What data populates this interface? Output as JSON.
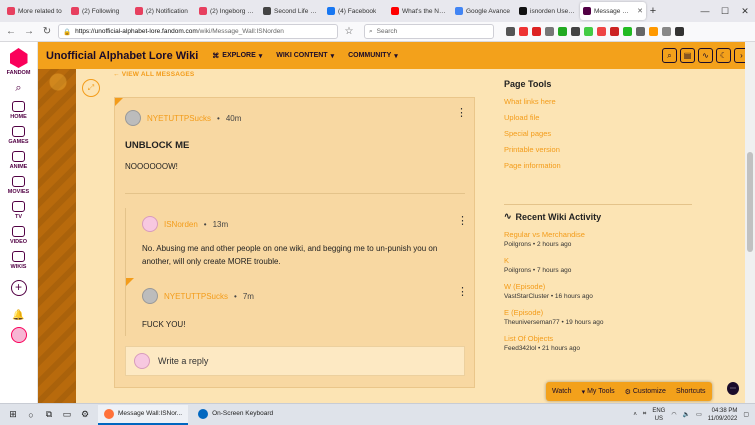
{
  "browser": {
    "tabs": [
      {
        "label": "More related to",
        "color": "#e7405f"
      },
      {
        "label": "(2) Following",
        "color": "#e7405f"
      },
      {
        "label": "(2) Notification",
        "color": "#e7405f"
      },
      {
        "label": "(2) Ingeborg Ne",
        "color": "#e7405f"
      },
      {
        "label": "Second Life Ma",
        "color": "#444444"
      },
      {
        "label": "(4) Facebook",
        "color": "#1877f2"
      },
      {
        "label": "What's the New",
        "color": "#ff0000"
      },
      {
        "label": "Google Avance",
        "color": "#4285f4"
      },
      {
        "label": "isnorden User P",
        "color": "#111111"
      },
      {
        "label": "Message Wall",
        "color": "#520044"
      }
    ],
    "url_host": "https://unofficial-alphabet-lore.fandom.com",
    "url_path": "/wiki/Message_Wall:ISNorden",
    "search_placeholder": "Search"
  },
  "rail": {
    "brand": "FANDOM",
    "items": [
      "HOME",
      "GAMES",
      "ANIME",
      "MOVIES",
      "TV",
      "VIDEO",
      "WIKIS"
    ]
  },
  "wiki": {
    "title": "Unofficial Alphabet Lore Wiki",
    "nav": [
      "EXPLORE",
      "WIKI CONTENT",
      "COMMUNITY"
    ],
    "accent": "#f39c1a"
  },
  "thread": {
    "view_all": "VIEW ALL MESSAGES",
    "post": {
      "author": "NYETUTTPSucks",
      "time": "40m",
      "title": "UNBLOCK ME",
      "body": "NOOOOOOW!"
    },
    "replies": [
      {
        "author": "ISNorden",
        "time": "13m",
        "text": "No.  Abusing me and other people on one wiki, and begging me to un-punish you on another, will only create MORE trouble."
      },
      {
        "author": "NYETUTTPSucks",
        "time": "7m",
        "text": "FUCK YOU!"
      }
    ],
    "reply_placeholder": "Write a reply"
  },
  "sidebar": {
    "page_tools_title": "Page Tools",
    "page_tools": [
      "What links here",
      "Upload file",
      "Special pages",
      "Printable version",
      "Page information"
    ],
    "activity_title": "Recent Wiki Activity",
    "activity": [
      {
        "title": "Regular vs Merchandise",
        "meta": "Poilgrons • 2 hours ago"
      },
      {
        "title": "K",
        "meta": "Poilgrons • 7 hours ago"
      },
      {
        "title": "W (Episode)",
        "meta": "VastStarCluster • 16 hours ago"
      },
      {
        "title": "E (Episode)",
        "meta": "Theuniverseman77 • 19 hours ago"
      },
      {
        "title": "List Of Objects",
        "meta": "Feed342lol • 21 hours ago"
      }
    ]
  },
  "toolbar": {
    "watch": "Watch",
    "my_tools": "My Tools",
    "customize": "Customize",
    "shortcuts": "Shortcuts"
  },
  "taskbar": {
    "apps": [
      {
        "label": "Message Wall:ISNor...",
        "color": "#ff7139"
      },
      {
        "label": "On-Screen Keyboard",
        "color": "#0067c0"
      }
    ],
    "lang_top": "ENG",
    "lang_bottom": "US",
    "time": "04:38 PM",
    "date": "11/09/2022"
  }
}
